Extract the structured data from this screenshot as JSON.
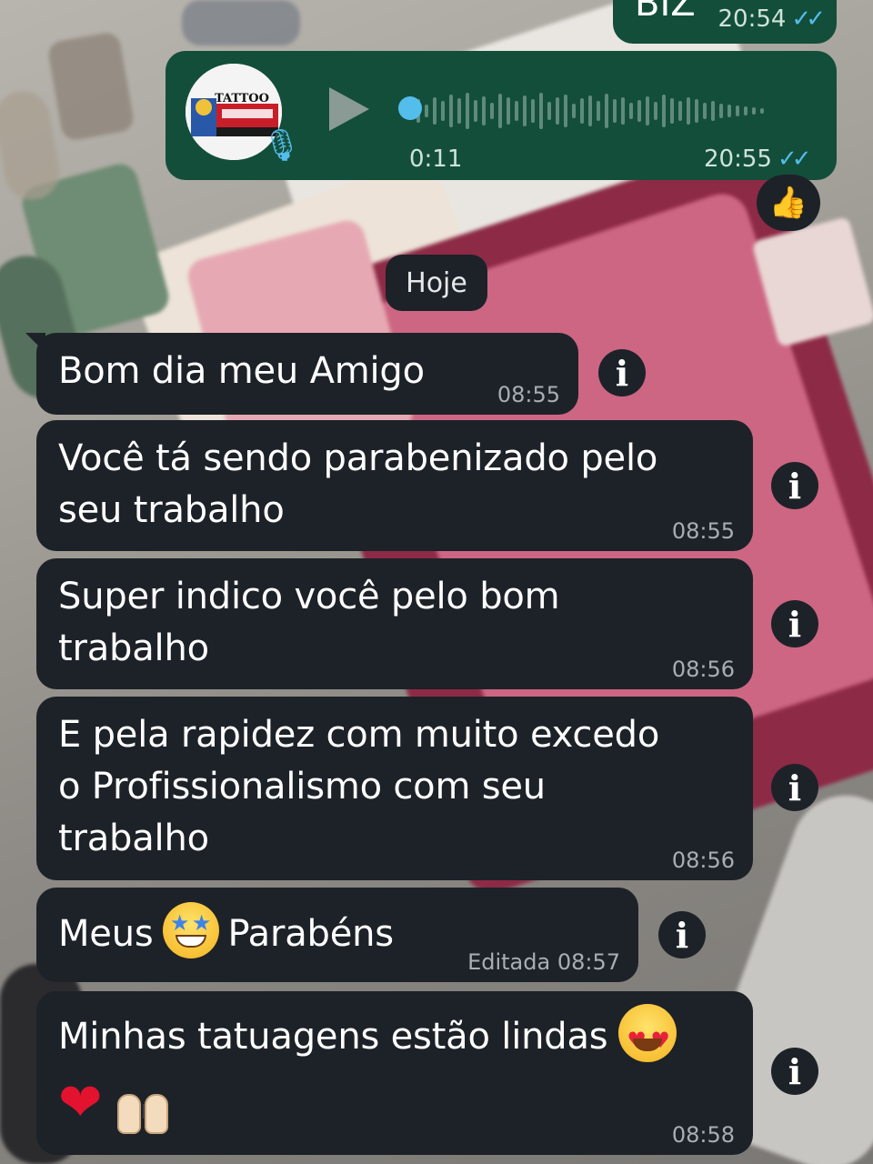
{
  "prev_message": {
    "text": "BIZ",
    "time": "20:54"
  },
  "audio_message": {
    "duration": "0:11",
    "time": "20:55",
    "avatar_label": "TATTOO",
    "reaction": "👍"
  },
  "date_chip": "Hoje",
  "messages": [
    {
      "text_lines": [
        "Bom dia meu Amigo"
      ],
      "time": "08:55"
    },
    {
      "text_lines": [
        "Você tá sendo parabenizado pelo",
        "seu trabalho"
      ],
      "time": "08:55"
    },
    {
      "text_lines": [
        "Super indico você pelo bom",
        "trabalho"
      ],
      "time": "08:56"
    },
    {
      "text_lines": [
        "E pela rapidez com muito excedo",
        "o Profissionalismo com seu",
        "trabalho"
      ],
      "time": "08:56"
    },
    {
      "text_before": "Meus",
      "text_after": "Parabéns",
      "edited_label": "Editada",
      "time": "08:57"
    },
    {
      "text_lines": [
        "Minhas tatuagens estão lindas"
      ],
      "time": "08:58"
    }
  ],
  "info_glyph": "i",
  "colors": {
    "incoming_bubble": "#1d2228",
    "outgoing_bubble": "#134e3a",
    "ticks": "#53bdeb"
  }
}
